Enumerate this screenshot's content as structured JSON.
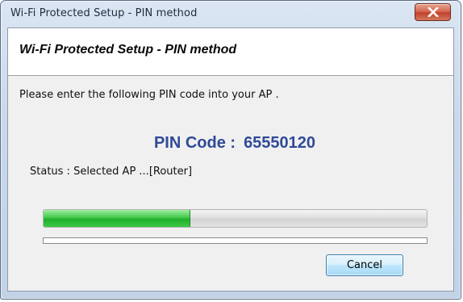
{
  "window": {
    "title": "Wi-Fi Protected Setup - PIN method"
  },
  "header": {
    "title": "Wi-Fi Protected Setup - PIN method"
  },
  "main": {
    "instruction": "Please enter the following PIN code into your AP .",
    "pin_label": "PIN Code :",
    "pin_value": "65550120",
    "status_text": "Status : Selected AP ...[Router]"
  },
  "progress": {
    "fraction": 0.38
  },
  "buttons": {
    "cancel_label": "Cancel"
  },
  "colors": {
    "pin_text": "#2f4a97",
    "progress_fill": "#3cc845",
    "close_button": "#c2412a"
  },
  "icons": {
    "close": "close-icon"
  }
}
